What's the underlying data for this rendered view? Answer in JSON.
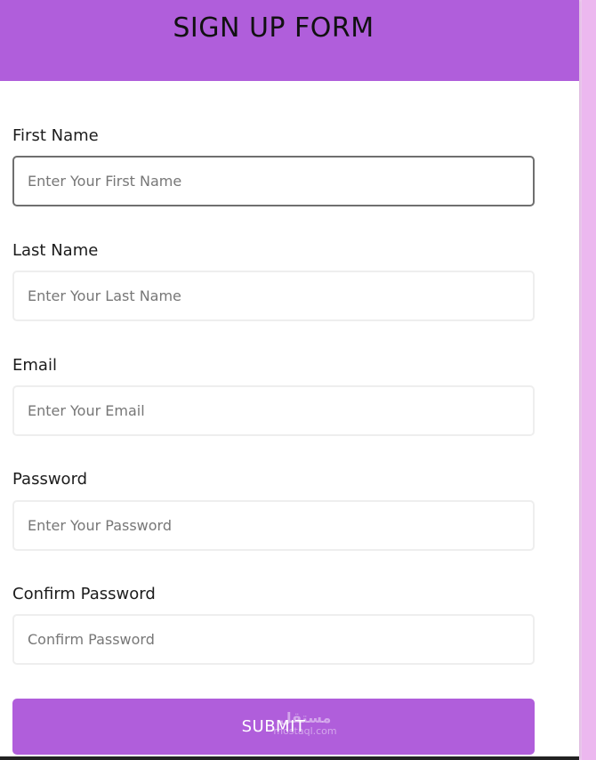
{
  "header": {
    "title": "SIGN UP FORM"
  },
  "fields": {
    "first_name": {
      "label": "First Name",
      "placeholder": "Enter Your First Name",
      "value": ""
    },
    "last_name": {
      "label": "Last Name",
      "placeholder": "Enter Your Last Name",
      "value": ""
    },
    "email": {
      "label": "Email",
      "placeholder": "Enter Your Email",
      "value": ""
    },
    "password": {
      "label": "Password",
      "placeholder": "Enter Your Password",
      "value": ""
    },
    "confirm_password": {
      "label": "Confirm Password",
      "placeholder": "Confirm Password",
      "value": ""
    }
  },
  "submit": {
    "label": "SUBMIT"
  },
  "watermark": {
    "arabic": "مستقل",
    "latin": "mostaql.com"
  },
  "colors": {
    "accent": "#b05edb",
    "page_background": "#f1cdf3",
    "card": "#ffffff",
    "input_border": "#eeeeee",
    "input_focus_border": "#6f6f6f"
  }
}
